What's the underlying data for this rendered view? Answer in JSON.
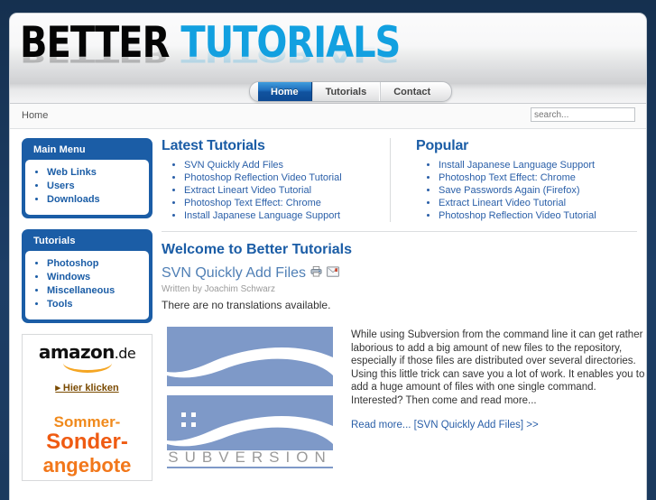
{
  "site": {
    "logo_word1": "BETTER",
    "logo_word2": "TUTORIALS"
  },
  "nav": {
    "items": [
      {
        "label": "Home",
        "active": true
      },
      {
        "label": "Tutorials",
        "active": false
      },
      {
        "label": "Contact",
        "active": false
      }
    ]
  },
  "breadcrumb": "Home",
  "search": {
    "placeholder": "search...",
    "value": ""
  },
  "sidebar": {
    "modules": [
      {
        "title": "Main Menu",
        "items": [
          "Web Links",
          "Users",
          "Downloads"
        ]
      },
      {
        "title": "Tutorials",
        "items": [
          "Photoshop",
          "Windows",
          "Miscellaneous",
          "Tools"
        ]
      }
    ],
    "ad": {
      "brand": "amazon",
      "brand_tld": ".de",
      "cta": "▸ Hier klicken",
      "line1": "Sommer-",
      "line2": "Sonder-",
      "line3": "angebote"
    }
  },
  "main": {
    "latest": {
      "heading": "Latest Tutorials",
      "items": [
        "SVN Quickly Add Files",
        "Photoshop Reflection Video Tutorial",
        "Extract Lineart Video Tutorial",
        "Photoshop Text Effect: Chrome",
        "Install Japanese Language Support"
      ]
    },
    "popular": {
      "heading": "Popular",
      "items": [
        "Install Japanese Language Support",
        "Photoshop Text Effect: Chrome",
        "Save Passwords Again (Firefox)",
        "Extract Lineart Video Tutorial",
        "Photoshop Reflection Video Tutorial"
      ]
    },
    "welcome_heading": "Welcome to Better Tutorials",
    "article": {
      "title": "SVN Quickly Add Files",
      "byline": "Written by Joachim Schwarz",
      "translation_note": "There are no translations available.",
      "image_caption": "SUBVERSION",
      "text": "While using Subversion from the command line it can get rather laborious to add a big amount of new files to the repository, especially if those files are distributed over several directories. Using this little trick can save you a lot of work. It enables you to add a huge amount of files with one single command. Interested? Then come and read more...",
      "read_more": "Read more... [SVN Quickly Add Files] >>"
    }
  },
  "colors": {
    "page_bg": "#1b3a5e",
    "module_blue": "#1b5da6",
    "logo_cyan": "#12a0e0",
    "link_blue": "#2a5fa8",
    "svn_blue": "#7e99c8",
    "amazon_orange": "#f08a1c"
  }
}
